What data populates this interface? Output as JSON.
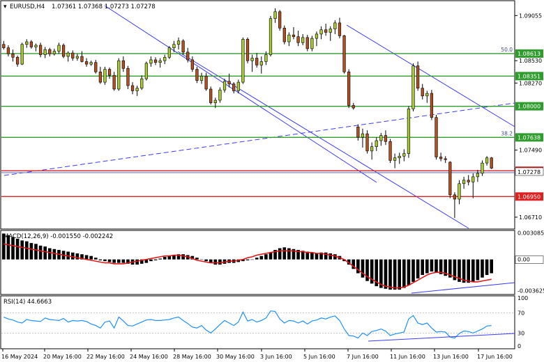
{
  "chart_data": [
    {
      "type": "candlestick",
      "symbol_header": "EURUSD,H4",
      "ohlc_header": "1.07361 1.07368 1.07273 1.07278",
      "ylim": [
        1.0658,
        1.0922
      ],
      "price_axis_ticks": [
        "1.09055",
        "1.08530",
        "1.08270",
        "1.07490",
        "1.06710"
      ],
      "horizontal_levels": [
        {
          "label": "1.08613",
          "value": 1.08613,
          "color": "#2e9d2e",
          "fib": "50.0"
        },
        {
          "label": "1.08351",
          "value": 1.08351,
          "color": "#2e9d2e"
        },
        {
          "label": "1.08000",
          "value": 1.08,
          "color": "#2e9d2e"
        },
        {
          "label": "1.07638",
          "value": 1.07638,
          "color": "#2e9d2e",
          "fib": "38.2"
        },
        {
          "label": "1.07250",
          "value": 1.0725,
          "color": "#dd2020"
        },
        {
          "label": "1.06950",
          "value": 1.0695,
          "color": "#dd2020"
        }
      ],
      "current_price": {
        "label": "1.07278",
        "value": 1.07278
      },
      "x_labels": [
        "16 May 2024",
        "20 May 16:00",
        "22 May 16:00",
        "24 May 16:00",
        "28 May 16:00",
        "30 May 16:00",
        "3 Jun 16:00",
        "5 Jun 16:00",
        "7 Jun 16:00",
        "11 Jun 16:00",
        "13 Jun 16:00",
        "17 Jun 16:00"
      ],
      "candles": [
        [
          1.0872,
          1.0876,
          1.0866,
          1.0868
        ],
        [
          1.0868,
          1.0871,
          1.0858,
          1.0861
        ],
        [
          1.0861,
          1.0866,
          1.0852,
          1.0857
        ],
        [
          1.0857,
          1.0859,
          1.0846,
          1.0849
        ],
        [
          1.0849,
          1.0874,
          1.0848,
          1.0872
        ],
        [
          1.0872,
          1.0878,
          1.0868,
          1.0875
        ],
        [
          1.0875,
          1.0877,
          1.0867,
          1.0869
        ],
        [
          1.0869,
          1.0873,
          1.0864,
          1.0871
        ],
        [
          1.0871,
          1.0874,
          1.0857,
          1.086
        ],
        [
          1.086,
          1.0869,
          1.0856,
          1.0866
        ],
        [
          1.0866,
          1.0868,
          1.0858,
          1.0861
        ],
        [
          1.0861,
          1.0867,
          1.0859,
          1.0864
        ],
        [
          1.0864,
          1.0874,
          1.0861,
          1.0871
        ],
        [
          1.0871,
          1.0873,
          1.0856,
          1.0858
        ],
        [
          1.0858,
          1.0864,
          1.0852,
          1.0862
        ],
        [
          1.0862,
          1.0865,
          1.0853,
          1.0856
        ],
        [
          1.0856,
          1.0861,
          1.0853,
          1.0858
        ],
        [
          1.0858,
          1.0864,
          1.0851,
          1.0852
        ],
        [
          1.0852,
          1.0856,
          1.0846,
          1.0849
        ],
        [
          1.0849,
          1.0853,
          1.0847,
          1.0851
        ],
        [
          1.0851,
          1.0854,
          1.0838,
          1.084
        ],
        [
          1.084,
          1.0846,
          1.0826,
          1.0828
        ],
        [
          1.0828,
          1.0846,
          1.0825,
          1.0843
        ],
        [
          1.0843,
          1.0845,
          1.0832,
          1.0836
        ],
        [
          1.0836,
          1.084,
          1.0818,
          1.082
        ],
        [
          1.082,
          1.0856,
          1.0818,
          1.0853
        ],
        [
          1.0853,
          1.0858,
          1.084,
          1.0844
        ],
        [
          1.0844,
          1.0847,
          1.082,
          1.0824
        ],
        [
          1.0824,
          1.0828,
          1.0814,
          1.0818
        ],
        [
          1.0818,
          1.0824,
          1.0812,
          1.0821
        ],
        [
          1.0821,
          1.0836,
          1.0819,
          1.0832
        ],
        [
          1.0832,
          1.0852,
          1.083,
          1.085
        ],
        [
          1.085,
          1.0858,
          1.0846,
          1.0854
        ],
        [
          1.0854,
          1.0857,
          1.0848,
          1.0851
        ],
        [
          1.0851,
          1.0856,
          1.0845,
          1.0853
        ],
        [
          1.0853,
          1.086,
          1.0849,
          1.0857
        ],
        [
          1.0857,
          1.087,
          1.0855,
          1.0868
        ],
        [
          1.0868,
          1.0876,
          1.0863,
          1.0872
        ],
        [
          1.0872,
          1.088,
          1.0866,
          1.0876
        ],
        [
          1.0876,
          1.0878,
          1.086,
          1.0863
        ],
        [
          1.0863,
          1.0868,
          1.0851,
          1.0854
        ],
        [
          1.0854,
          1.0858,
          1.084,
          1.0843
        ],
        [
          1.0843,
          1.0846,
          1.0827,
          1.083
        ],
        [
          1.083,
          1.0839,
          1.0826,
          1.0835
        ],
        [
          1.0835,
          1.0839,
          1.0818,
          1.082
        ],
        [
          1.082,
          1.0823,
          1.0802,
          1.0804
        ],
        [
          1.0804,
          1.081,
          1.0798,
          1.0807
        ],
        [
          1.0807,
          1.0822,
          1.0804,
          1.0819
        ],
        [
          1.0819,
          1.0832,
          1.0816,
          1.0829
        ],
        [
          1.0829,
          1.0838,
          1.0822,
          1.0826
        ],
        [
          1.0826,
          1.0828,
          1.0815,
          1.0818
        ],
        [
          1.0818,
          1.0831,
          1.0815,
          1.0828
        ],
        [
          1.0828,
          1.088,
          1.0826,
          1.0878
        ],
        [
          1.0878,
          1.088,
          1.085,
          1.0853
        ],
        [
          1.0853,
          1.086,
          1.084,
          1.0856
        ],
        [
          1.0856,
          1.0862,
          1.0845,
          1.0848
        ],
        [
          1.0848,
          1.0858,
          1.0838,
          1.0852
        ],
        [
          1.0852,
          1.0864,
          1.0848,
          1.086
        ],
        [
          1.086,
          1.0905,
          1.0858,
          1.0902
        ],
        [
          1.0902,
          1.0914,
          1.0897,
          1.091
        ],
        [
          1.091,
          1.0912,
          1.0888,
          1.0891
        ],
        [
          1.0891,
          1.0894,
          1.0872,
          1.0875
        ],
        [
          1.0875,
          1.0886,
          1.087,
          1.0883
        ],
        [
          1.0883,
          1.0892,
          1.0878,
          1.0881
        ],
        [
          1.0881,
          1.0888,
          1.087,
          1.0874
        ],
        [
          1.0874,
          1.0884,
          1.0871,
          1.088
        ],
        [
          1.088,
          1.0883,
          1.0864,
          1.0867
        ],
        [
          1.0867,
          1.0882,
          1.0864,
          1.0879
        ],
        [
          1.0879,
          1.0887,
          1.087,
          1.0884
        ],
        [
          1.0884,
          1.0893,
          1.0878,
          1.0889
        ],
        [
          1.0889,
          1.0896,
          1.0882,
          1.0886
        ],
        [
          1.0886,
          1.0893,
          1.0876,
          1.089
        ],
        [
          1.089,
          1.09,
          1.0884,
          1.0897
        ],
        [
          1.0897,
          1.0903,
          1.0879,
          1.0882
        ],
        [
          1.0882,
          1.0883,
          1.0838,
          1.084
        ],
        [
          1.084,
          1.0843,
          1.0798,
          1.0801
        ],
        [
          1.0801,
          1.0804,
          1.0796,
          1.0798
        ],
        [
          1.0776,
          1.0779,
          1.076,
          1.0764
        ],
        [
          1.0764,
          1.0774,
          1.0752,
          1.0768
        ],
        [
          1.0768,
          1.0772,
          1.0745,
          1.0748
        ],
        [
          1.0748,
          1.0758,
          1.0738,
          1.0753
        ],
        [
          1.0753,
          1.0764,
          1.0748,
          1.076
        ],
        [
          1.076,
          1.0769,
          1.0754,
          1.0766
        ],
        [
          1.0766,
          1.0772,
          1.0755,
          1.0759
        ],
        [
          1.0759,
          1.0762,
          1.0734,
          1.0737
        ],
        [
          1.0737,
          1.0745,
          1.0728,
          1.074
        ],
        [
          1.074,
          1.0746,
          1.0733,
          1.0742
        ],
        [
          1.0742,
          1.075,
          1.0736,
          1.0745
        ],
        [
          1.0745,
          1.08,
          1.074,
          1.0797
        ],
        [
          1.0797,
          1.085,
          1.0794,
          1.0847
        ],
        [
          1.0847,
          1.0852,
          1.0818,
          1.0821
        ],
        [
          1.0821,
          1.0826,
          1.0808,
          1.0812
        ],
        [
          1.0812,
          1.0818,
          1.0804,
          1.0815
        ],
        [
          1.0815,
          1.0819,
          1.0784,
          1.0787
        ],
        [
          1.0787,
          1.079,
          1.0738,
          1.0741
        ],
        [
          1.0741,
          1.0746,
          1.0736,
          1.0739
        ],
        [
          1.0739,
          1.0742,
          1.0734,
          1.0738
        ],
        [
          1.0735,
          1.0736,
          1.0693,
          1.0697
        ],
        [
          1.0697,
          1.07,
          1.067,
          1.0692
        ],
        [
          1.0692,
          1.0714,
          1.0686,
          1.071
        ],
        [
          1.071,
          1.0718,
          1.0704,
          1.0714
        ],
        [
          1.0714,
          1.072,
          1.0708,
          1.0712
        ],
        [
          1.0712,
          1.0722,
          1.0693,
          1.0718
        ],
        [
          1.0718,
          1.0726,
          1.0712,
          1.0722
        ],
        [
          1.0722,
          1.0737,
          1.0719,
          1.0734
        ],
        [
          1.0734,
          1.0742,
          1.0731,
          1.074
        ],
        [
          1.074,
          1.0741,
          1.0727,
          1.0728
        ]
      ]
    },
    {
      "type": "histogram",
      "label": "MACD(12,26,9) -0.001550 -0.002242",
      "ticks": [
        "0.003085",
        "0.00",
        "-0.003625"
      ],
      "ylim": [
        -0.0039,
        0.0032
      ],
      "histogram": [
        0.003,
        0.0028,
        0.0026,
        0.0024,
        0.0022,
        0.0021,
        0.0019,
        0.0018,
        0.0016,
        0.0015,
        0.0013,
        0.0012,
        0.0011,
        0.001,
        0.0009,
        0.0008,
        0.0007,
        0.0006,
        0.0005,
        0.0004,
        0.0002,
        -0.0001,
        -0.0002,
        -0.0003,
        -0.0004,
        -0.0004,
        -0.0004,
        -0.0005,
        -0.0006,
        -0.0006,
        -0.0005,
        -0.0004,
        -0.0002,
        -0.0001,
        0.0001,
        0.0003,
        0.0004,
        0.0005,
        0.0006,
        0.0006,
        0.0005,
        0.0004,
        0.0002,
        0.0,
        -0.0002,
        -0.0004,
        -0.0006,
        -0.0006,
        -0.0005,
        -0.0004,
        -0.0004,
        -0.0003,
        -0.0002,
        -0.0001,
        0.0,
        0.0002,
        0.0004,
        0.0006,
        0.0008,
        0.0011,
        0.0013,
        0.0014,
        0.0013,
        0.0012,
        0.0011,
        0.001,
        0.0009,
        0.0008,
        0.0007,
        0.0008,
        0.0008,
        0.0007,
        0.0006,
        0.0004,
        -0.0002,
        -0.0006,
        -0.0011,
        -0.0016,
        -0.0021,
        -0.0025,
        -0.0028,
        -0.0031,
        -0.0033,
        -0.0034,
        -0.0035,
        -0.0035,
        -0.0035,
        -0.0033,
        -0.003,
        -0.0026,
        -0.0022,
        -0.0018,
        -0.0016,
        -0.0014,
        -0.0015,
        -0.0017,
        -0.0019,
        -0.0021,
        -0.0024,
        -0.0026,
        -0.0027,
        -0.0027,
        -0.0026,
        -0.0024,
        -0.0021,
        -0.0018,
        -0.0016
      ],
      "signal": [
        0.0018,
        0.0017,
        0.0016,
        0.0015,
        0.0014,
        0.0013,
        0.0012,
        0.0011,
        0.001,
        0.0009,
        0.0008,
        0.0007,
        0.0006,
        0.0005,
        0.0004,
        0.0003,
        0.0002,
        0.0001,
        0.0,
        -0.0001,
        -0.0002,
        -0.0003,
        -0.0004,
        -0.0004,
        -0.0005,
        -0.0005,
        -0.0005,
        -0.0004,
        -0.0003,
        -0.0002,
        -0.0001,
        0.0,
        0.0001,
        0.0002,
        0.0003,
        0.0004,
        0.0004,
        0.0005,
        0.0005,
        0.0004,
        0.0003,
        0.0001,
        -0.0001,
        -0.0002,
        -0.0003,
        -0.0004,
        -0.0004,
        -0.0004,
        -0.0003,
        -0.0002,
        -0.0002,
        -0.0001,
        0.0,
        0.0002,
        0.0003,
        0.0005,
        0.0006,
        0.0007,
        0.0008,
        0.0009,
        0.001,
        0.001,
        0.001,
        0.001,
        0.0009,
        0.0009,
        0.0008,
        0.0008,
        0.0007,
        0.0007,
        0.0006,
        0.0005,
        0.0004,
        0.0002,
        0.0,
        -0.0004,
        -0.0008,
        -0.0012,
        -0.0016,
        -0.002,
        -0.0023,
        -0.0026,
        -0.0029,
        -0.0031,
        -0.0032,
        -0.0033,
        -0.0033,
        -0.0032,
        -0.003,
        -0.0027,
        -0.0024,
        -0.0021,
        -0.0018,
        -0.0016,
        -0.0015,
        -0.0015,
        -0.0016,
        -0.0018,
        -0.002,
        -0.0022,
        -0.0024,
        -0.0025,
        -0.0026,
        -0.0026,
        -0.0025,
        -0.0024,
        -0.0023
      ]
    },
    {
      "type": "line",
      "label": "RSI(14) 44.6663",
      "ticks": [
        "100",
        "70",
        "30",
        "0"
      ],
      "ylim": [
        0,
        100
      ],
      "levels": [
        70,
        30
      ],
      "values": [
        62,
        58,
        56,
        52,
        50,
        57,
        55,
        54,
        53,
        60,
        57,
        56,
        55,
        59,
        52,
        55,
        54,
        55,
        53,
        48,
        45,
        40,
        52,
        54,
        40,
        62,
        54,
        45,
        44,
        48,
        52,
        56,
        57,
        55,
        55,
        56,
        57,
        60,
        62,
        55,
        49,
        42,
        40,
        45,
        36,
        30,
        38,
        47,
        55,
        50,
        45,
        52,
        72,
        54,
        57,
        52,
        55,
        60,
        74,
        73,
        58,
        50,
        55,
        54,
        50,
        54,
        48,
        54,
        56,
        60,
        58,
        62,
        64,
        55,
        38,
        25,
        24,
        20,
        30,
        25,
        33,
        35,
        38,
        34,
        25,
        28,
        30,
        32,
        58,
        65,
        50,
        47,
        50,
        40,
        32,
        33,
        32,
        22,
        20,
        29,
        34,
        33,
        30,
        34,
        38,
        44,
        45
      ]
    }
  ]
}
